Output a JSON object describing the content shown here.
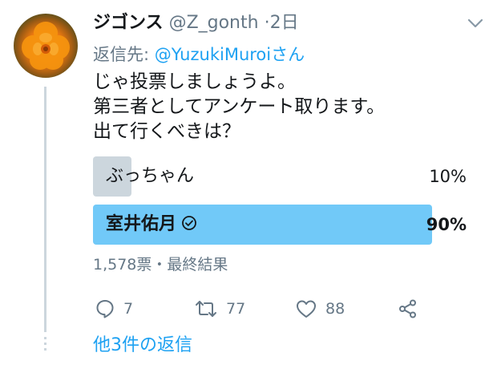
{
  "tweet": {
    "display_name": "ジゴンス",
    "handle": "@Z_gonth",
    "separator": "·",
    "time": "2日",
    "reply_prefix": "返信先: ",
    "reply_to": "@YuzukiMuroiさん",
    "text_lines": [
      "じゃ投票しましょうよ。",
      "第三者としてアンケート取ります。",
      "出て行くべきは？"
    ]
  },
  "poll": {
    "options": [
      {
        "label": "ぶっちゃん",
        "percent_text": "10%",
        "share": 0.1,
        "winner": false
      },
      {
        "label": "室井佑月",
        "percent_text": "90%",
        "share": 0.9,
        "winner": true
      }
    ],
    "meta": "1,578票・最終結果"
  },
  "actions": {
    "reply_count": "7",
    "retweet_count": "77",
    "like_count": "88"
  },
  "more_replies": "他3件の返信",
  "colors": {
    "accent": "#1da1f2",
    "winner_bar": "#71c9f8",
    "loser_bar": "#ccd6dd",
    "muted_text": "#657786"
  },
  "icons": [
    "avatar",
    "chevron-down-icon",
    "checkmark-circle-icon",
    "reply-icon",
    "retweet-icon",
    "like-icon",
    "share-icon"
  ]
}
